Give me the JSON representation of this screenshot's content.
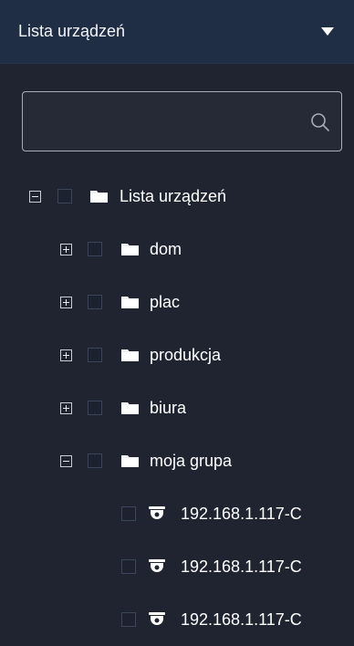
{
  "header": {
    "title": "Lista urządzeń",
    "dropdown_icon": "caret-down-icon"
  },
  "search": {
    "value": "",
    "placeholder": "",
    "icon": "search-icon"
  },
  "tree": {
    "root": {
      "label": "Lista urządzeń",
      "expanded": true
    },
    "groups": [
      {
        "label": "dom",
        "expanded": false
      },
      {
        "label": "plac",
        "expanded": false
      },
      {
        "label": "produkcja",
        "expanded": false
      },
      {
        "label": "biura",
        "expanded": false
      },
      {
        "label": "moja grupa",
        "expanded": true
      }
    ],
    "devices": [
      {
        "label": "192.168.1.117-C",
        "icon": "dome-camera-icon"
      },
      {
        "label": "192.168.1.117-C",
        "icon": "dome-camera-icon"
      },
      {
        "label": "192.168.1.117-C",
        "icon": "dome-camera-icon"
      }
    ]
  }
}
